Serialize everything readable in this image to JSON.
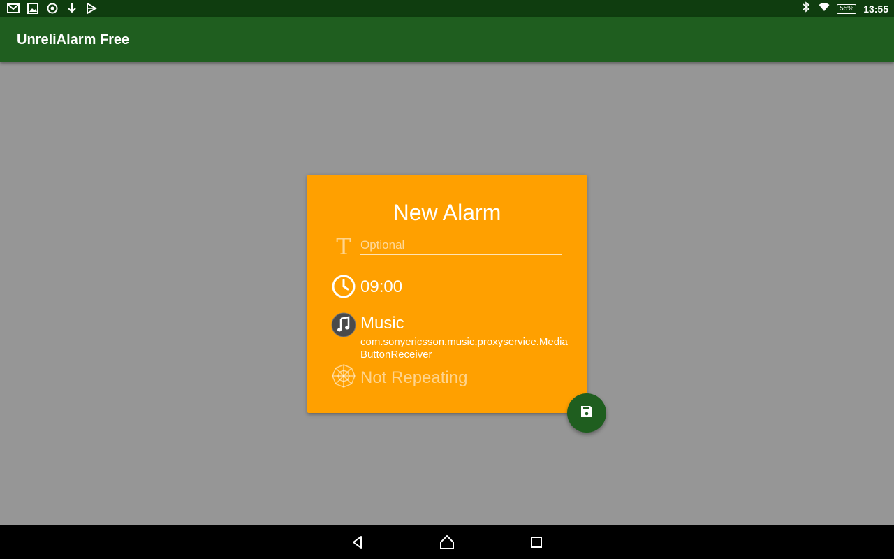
{
  "status_bar": {
    "left_icons": [
      "gmail-icon",
      "image-icon",
      "shield-icon",
      "download-icon",
      "play-store-icon"
    ],
    "right_icons": [
      "bluetooth-icon",
      "wifi-icon",
      "battery-icon"
    ],
    "battery": "55%",
    "time": "13:55"
  },
  "app_bar": {
    "title": "UnreliAlarm Free"
  },
  "dialog": {
    "title": "New Alarm",
    "label_placeholder": "Optional",
    "time": "09:00",
    "sound_title": "Music",
    "sound_subtitle": "com.sonyericsson.music.proxyservice.MediaButtonReceiver",
    "repeat": "Not Repeating"
  },
  "fab": {
    "icon": "save-icon"
  },
  "nav_bar": {
    "icons": [
      "back-icon",
      "home-icon",
      "recents-icon"
    ]
  },
  "colors": {
    "status_bar": "#0f3d0f",
    "app_bar": "#1f5e1f",
    "background": "#969696",
    "card": "#ffa000",
    "fab": "#1f5e1f"
  }
}
